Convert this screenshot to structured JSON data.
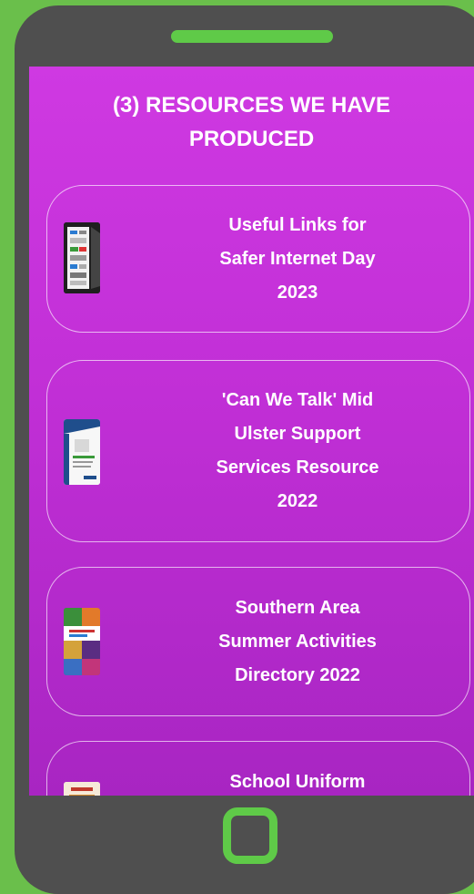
{
  "screen": {
    "title": "(3) RESOURCES WE HAVE\nPRODUCED"
  },
  "resources": [
    {
      "label": "Useful Links for\nSafer Internet Day\n2023"
    },
    {
      "label": "'Can We Talk' Mid\nUlster Support\nServices Resource\n2022"
    },
    {
      "label": "Southern Area\nSummer Activities\nDirectory 2022"
    },
    {
      "label": "School Uniform"
    }
  ],
  "colors": {
    "frame_green": "#6abf4b",
    "phone_body": "#4f4f4f",
    "screen_top": "#cf39e2",
    "screen_bottom": "#a825c2"
  }
}
